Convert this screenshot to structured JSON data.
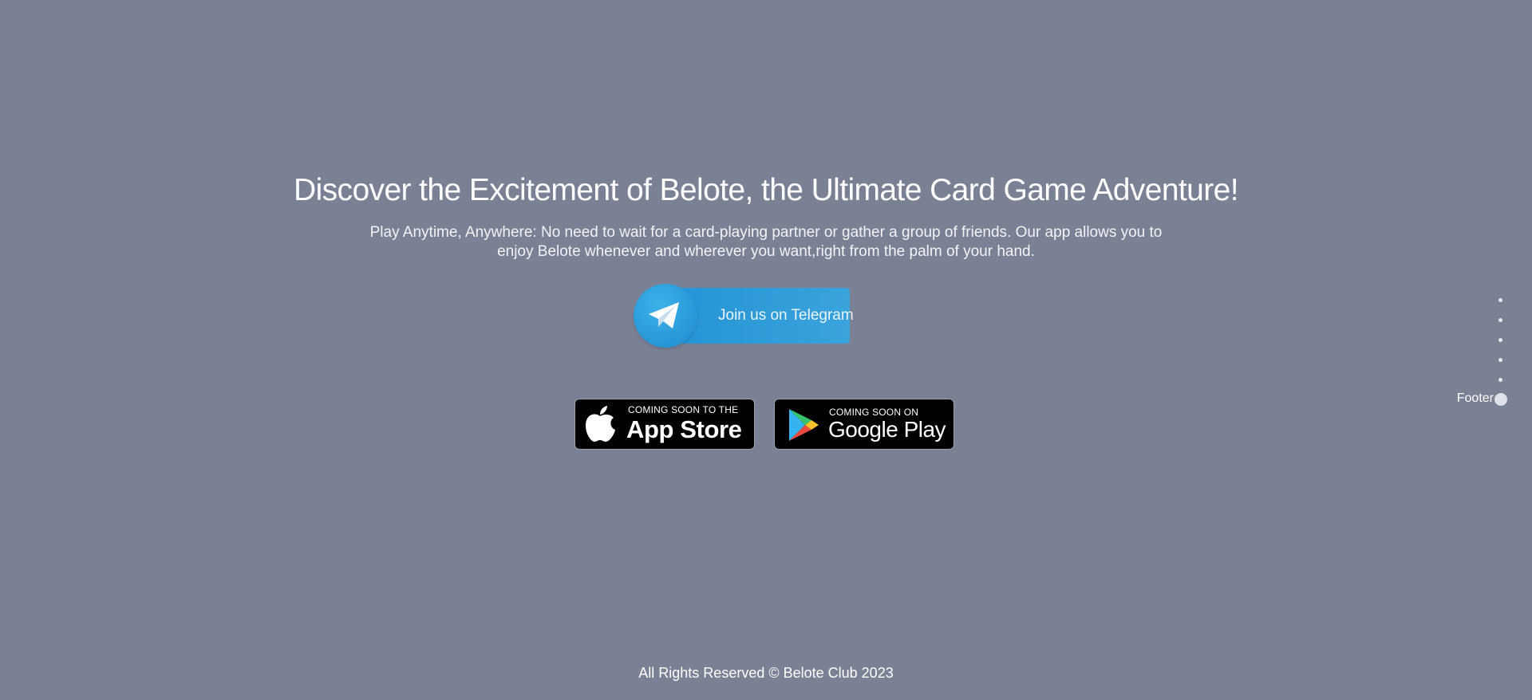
{
  "hero": {
    "title": "Discover the Excitement of Belote, the Ultimate Card Game Adventure!",
    "subtitle": "Play Anytime, Anywhere: No need to wait for a card-playing partner or gather a group of friends. Our app allows you to enjoy Belote whenever and wherever you want,right from the palm of your hand."
  },
  "telegram": {
    "label": "Join us on Telegram",
    "icon": "telegram-paper-plane-icon",
    "color": "#2a9ad9"
  },
  "stores": {
    "app_store": {
      "small": "COMING SOON TO THE",
      "big": "App Store",
      "icon": "apple-icon"
    },
    "google_play": {
      "small": "COMING SOON ON",
      "big": "Google Play",
      "icon": "google-play-icon"
    }
  },
  "side_nav": {
    "active_label": "Footer",
    "dot_count": 5
  },
  "footer": {
    "text": "All Rights Reserved © Belote Club 2023"
  },
  "colors": {
    "background": "#7a8194",
    "telegram_accent": "#2393d4",
    "text": "#ffffff"
  }
}
